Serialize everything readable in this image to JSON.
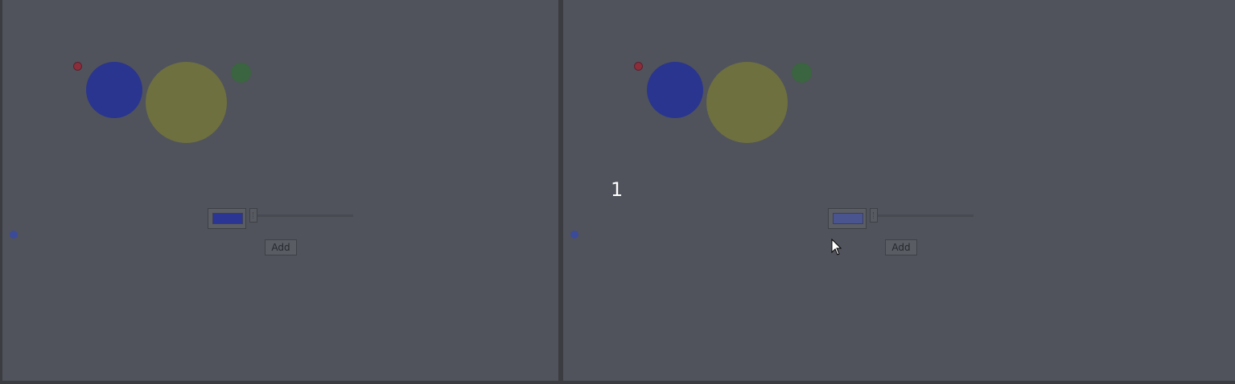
{
  "colors": {
    "background": "#50535b",
    "red_dot": "#8c2d3a",
    "blue_circle": "#2a358f",
    "olive_circle": "#6e7040",
    "green_circle": "#3b6440",
    "small_blue_dot": "#3c4a9a",
    "swatch_left": "#2a3594",
    "swatch_right": "#4a5590"
  },
  "panels": [
    {
      "counter": "",
      "add_label": "Add",
      "swatch_color": "#2a3594",
      "cursor_icon": ""
    },
    {
      "counter": "1",
      "add_label": "Add",
      "swatch_color": "#4a5590",
      "cursor_icon": "mouse-pointer-icon"
    }
  ]
}
